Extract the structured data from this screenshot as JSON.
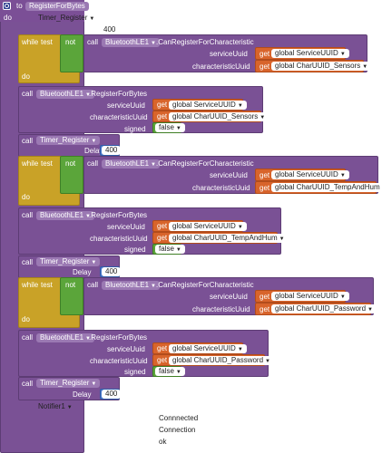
{
  "procedure": {
    "to_label": "to",
    "name": "RegisterForBytes",
    "do_label": "do",
    "param_timer": "Timer_Register",
    "param_value": "400"
  },
  "labels": {
    "while": "while",
    "test": "test",
    "not": "not",
    "call": "call",
    "do": "do",
    "serviceUuid": "serviceUuid",
    "characteristicUuid": "characteristicUuid",
    "signed": "signed",
    "delay": "Delay",
    "get": "get"
  },
  "components": {
    "ble": "BluetoothLE1",
    "timer": "Timer_Register",
    "notifier": "Notifier1"
  },
  "methods": {
    "canRegister": ".CanRegisterForCharacteristic",
    "registerBytes": ".RegisterForBytes"
  },
  "globals": {
    "service": "global ServiceUUID",
    "sensors": "global CharUUID_Sensors",
    "temp": "global CharUUID_TempAndHum",
    "password": "global CharUUID_Password"
  },
  "values": {
    "false": "false",
    "delay": "400"
  },
  "notifier_args": [
    "Connnected",
    "Connection",
    "ok"
  ]
}
